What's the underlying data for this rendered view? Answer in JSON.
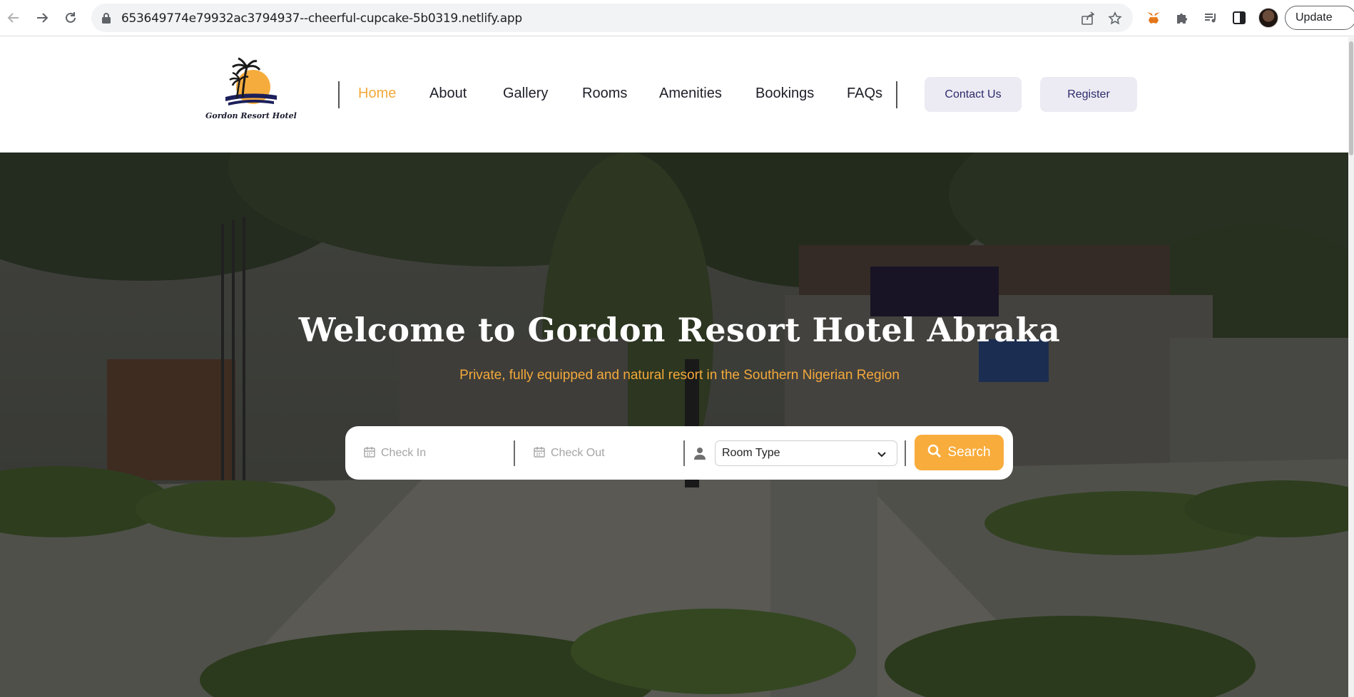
{
  "browser": {
    "url": "653649774e79932ac3794937--cheerful-cupcake-5b0319.netlify.app",
    "update_label": "Update"
  },
  "site": {
    "logo_text": "Gordon Resort Hotel",
    "menu": [
      {
        "label": "Home",
        "active": true
      },
      {
        "label": "About"
      },
      {
        "label": "Gallery"
      },
      {
        "label": "Rooms"
      },
      {
        "label": "Amenities"
      },
      {
        "label": "Bookings"
      },
      {
        "label": "FAQs"
      }
    ],
    "contact_label": "Contact Us",
    "register_label": "Register"
  },
  "hero": {
    "title": "Welcome to Gordon Resort Hotel Abraka",
    "subtitle": "Private, fully equipped and natural resort in the Southern Nigerian Region"
  },
  "search": {
    "check_in_placeholder": "Check In",
    "check_out_placeholder": "Check Out",
    "room_type_selected": "Room Type",
    "button_label": "Search"
  },
  "colors": {
    "accent": "#f4a93b",
    "button_text": "#2c2a6a",
    "pill_bg": "#ecebf3"
  }
}
